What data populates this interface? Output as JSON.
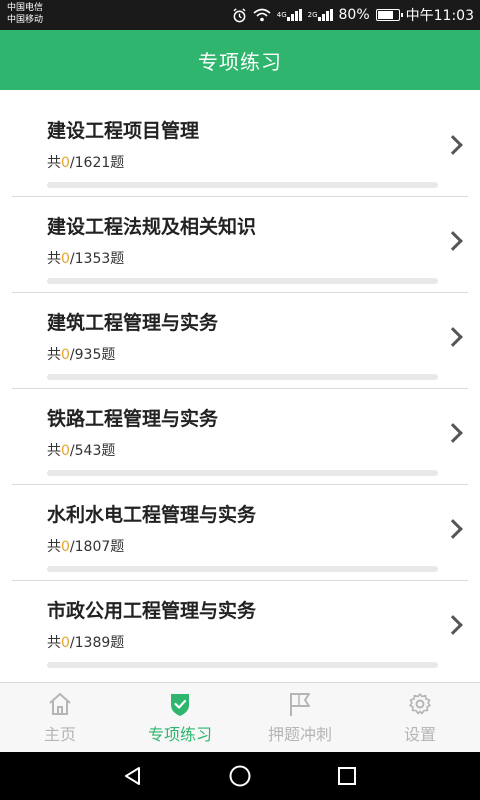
{
  "status_bar": {
    "carrier1": "中国电信",
    "carrier2": "中国移动",
    "alarm_icon": "alarm-icon",
    "wifi_icon": "wifi-icon",
    "net_label": "4G",
    "signal_label": "2G",
    "battery": "80%",
    "battery_level": 0.8,
    "time": "中午11:03"
  },
  "header": {
    "title": "专项练习"
  },
  "subjects": [
    {
      "title": "建设工程项目管理",
      "prefix": "共",
      "done": "0",
      "total": "/1621题",
      "progress": 0
    },
    {
      "title": "建设工程法规及相关知识",
      "prefix": "共",
      "done": "0",
      "total": "/1353题",
      "progress": 0
    },
    {
      "title": "建筑工程管理与实务",
      "prefix": "共",
      "done": "0",
      "total": "/935题",
      "progress": 0
    },
    {
      "title": "铁路工程管理与实务",
      "prefix": "共",
      "done": "0",
      "total": "/543题",
      "progress": 0
    },
    {
      "title": "水利水电工程管理与实务",
      "prefix": "共",
      "done": "0",
      "total": "/1807题",
      "progress": 0
    },
    {
      "title": "市政公用工程管理与实务",
      "prefix": "共",
      "done": "0",
      "total": "/1389题",
      "progress": 0
    }
  ],
  "bottom_nav": [
    {
      "label": "主页",
      "icon": "home-icon",
      "active": false
    },
    {
      "label": "专项练习",
      "icon": "shield-check-icon",
      "active": true
    },
    {
      "label": "押题冲刺",
      "icon": "flag-icon",
      "active": false
    },
    {
      "label": "设置",
      "icon": "gear-icon",
      "active": false
    }
  ],
  "colors": {
    "accent": "#2fb56e",
    "done": "#e8a52c",
    "inactive": "#b5b5b5"
  }
}
